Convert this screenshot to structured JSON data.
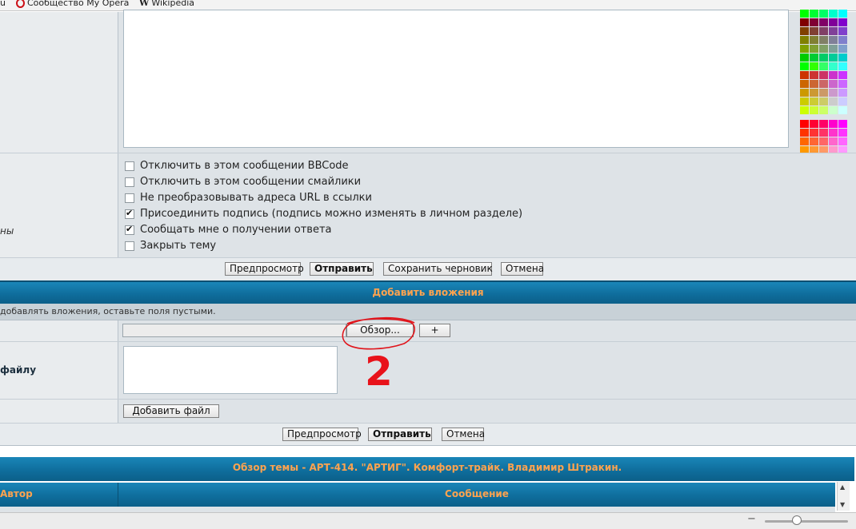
{
  "bookmarks": {
    "item1": "u",
    "item2": "Сообщество My Opera",
    "item3": "Wikipedia",
    "wiki_glyph": "W"
  },
  "palette_colors": [
    [
      "#00ff00",
      "#00ff33",
      "#00ff66",
      "#00ffcc",
      "#00ffff"
    ],
    [
      "#800000",
      "#800033",
      "#800066",
      "#800099",
      "#8000cc"
    ],
    [
      "#804000",
      "#804033",
      "#804066",
      "#804099",
      "#8040cc"
    ],
    [
      "#808000",
      "#808033",
      "#808066",
      "#808099",
      "#8080cc"
    ],
    [
      "#80a000",
      "#80a033",
      "#80a066",
      "#80a099",
      "#80a0cc"
    ],
    [
      "#00cc00",
      "#00cc33",
      "#00cc66",
      "#00cc99",
      "#00cccc"
    ],
    [
      "#00ff00",
      "#33ff00",
      "#33ff66",
      "#33ffcc",
      "#33ffff"
    ],
    [
      "#cc3300",
      "#cc3333",
      "#cc3366",
      "#cc33cc",
      "#cc33ff"
    ],
    [
      "#cc6600",
      "#cc6633",
      "#cc6666",
      "#cc66cc",
      "#cc66ff"
    ],
    [
      "#cc9900",
      "#cc9933",
      "#cc9966",
      "#cc99cc",
      "#cc99ff"
    ],
    [
      "#cccc00",
      "#cccc33",
      "#cccc66",
      "#cccccc",
      "#ccccff"
    ],
    [
      "#ccff00",
      "#ccff33",
      "#ccff66",
      "#ccffcc",
      "#ccffff"
    ],
    [
      "#ff0000",
      "#ff0033",
      "#ff0066",
      "#ff00cc",
      "#ff00ff"
    ],
    [
      "#ff3300",
      "#ff3333",
      "#ff3366",
      "#ff33cc",
      "#ff33ff"
    ],
    [
      "#ff6600",
      "#ff6633",
      "#ff6666",
      "#ff66cc",
      "#ff66ff"
    ],
    [
      "#ff9900",
      "#ff9933",
      "#ff9966",
      "#ff99cc",
      "#ff99ff"
    ],
    [
      "#ffcc00",
      "#ffcc33",
      "#ffcc66",
      "#ffcccc",
      "#ffccff"
    ],
    [
      "#ffff00",
      "#ffff33",
      "#ffff66",
      "#ffffcc",
      "#ffffff"
    ]
  ],
  "options": {
    "left_label": "ны",
    "items": [
      {
        "label": "Отключить в этом сообщении BBCode",
        "checked": false
      },
      {
        "label": "Отключить в этом сообщении смайлики",
        "checked": false
      },
      {
        "label": "Не преобразовывать адреса URL в ссылки",
        "checked": false
      },
      {
        "label": "Присоединить подпись (подпись можно изменять в личном разделе)",
        "checked": true
      },
      {
        "label": "Сообщать мне о получении ответа",
        "checked": true
      },
      {
        "label": "Закрыть тему",
        "checked": false
      }
    ]
  },
  "submit_row": {
    "preview": "Предпросмотр",
    "submit": "Отправить",
    "save_draft": "Сохранить черновик",
    "cancel": "Отмена"
  },
  "attachments": {
    "header": "Добавить вложения",
    "hint": "добавлять вложения, оставьте поля пустыми.",
    "browse": "Обзор...",
    "plus": "+",
    "comment_label": "файлу",
    "add_file": "Добавить файл",
    "annotation": "2"
  },
  "attach_submit_row": {
    "preview": "Предпросмотр",
    "submit": "Отправить",
    "cancel": "Отмена"
  },
  "topic_review": {
    "header": "Обзор темы - АРТ-414. \"АРТИГ\". Комфорт-трайк. Владимир Штракин.",
    "col_author": "Автор",
    "col_message": "Сообщение"
  },
  "statusbar": {
    "zoom_minus": "−"
  }
}
